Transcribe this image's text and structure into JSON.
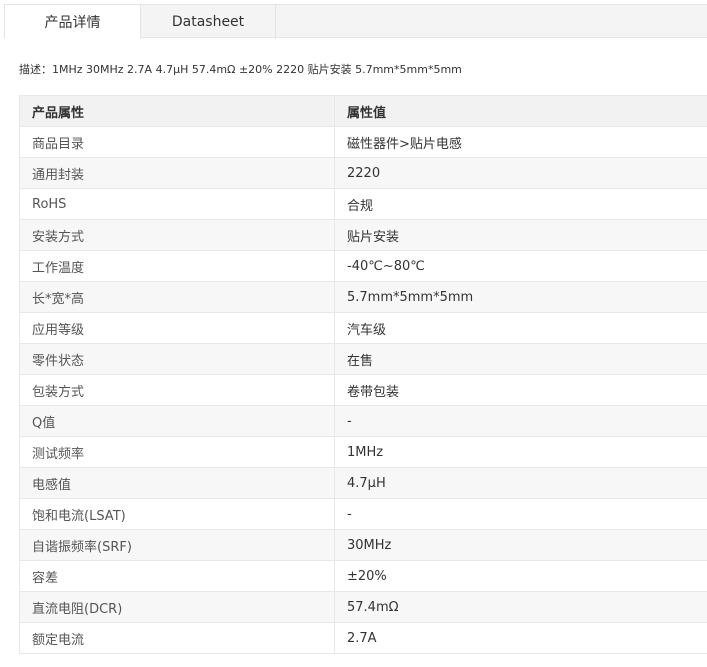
{
  "tabs": {
    "product_details": "产品详情",
    "datasheet": "Datasheet"
  },
  "description": "描述：1MHz 30MHz 2.7A 4.7μH 57.4mΩ ±20% 2220 贴片安装 5.7mm*5mm*5mm",
  "table": {
    "headers": {
      "property": "产品属性",
      "value": "属性值"
    },
    "rows": [
      {
        "name": "商品目录",
        "value": "磁性器件>贴片电感"
      },
      {
        "name": "通用封装",
        "value": "2220"
      },
      {
        "name": "RoHS",
        "value": "合规"
      },
      {
        "name": "安装方式",
        "value": "贴片安装"
      },
      {
        "name": "工作温度",
        "value": "-40℃~80℃"
      },
      {
        "name": "长*宽*高",
        "value": "5.7mm*5mm*5mm"
      },
      {
        "name": "应用等级",
        "value": "汽车级"
      },
      {
        "name": "零件状态",
        "value": "在售"
      },
      {
        "name": "包装方式",
        "value": "卷带包装"
      },
      {
        "name": "Q值",
        "value": "-"
      },
      {
        "name": "测试频率",
        "value": "1MHz"
      },
      {
        "name": "电感值",
        "value": "4.7μH"
      },
      {
        "name": "饱和电流(LSAT)",
        "value": "-"
      },
      {
        "name": "自谐振频率(SRF)",
        "value": "30MHz"
      },
      {
        "name": "容差",
        "value": "±20%"
      },
      {
        "name": "直流电阻(DCR)",
        "value": "57.4mΩ"
      },
      {
        "name": "额定电流",
        "value": "2.7A"
      }
    ]
  }
}
